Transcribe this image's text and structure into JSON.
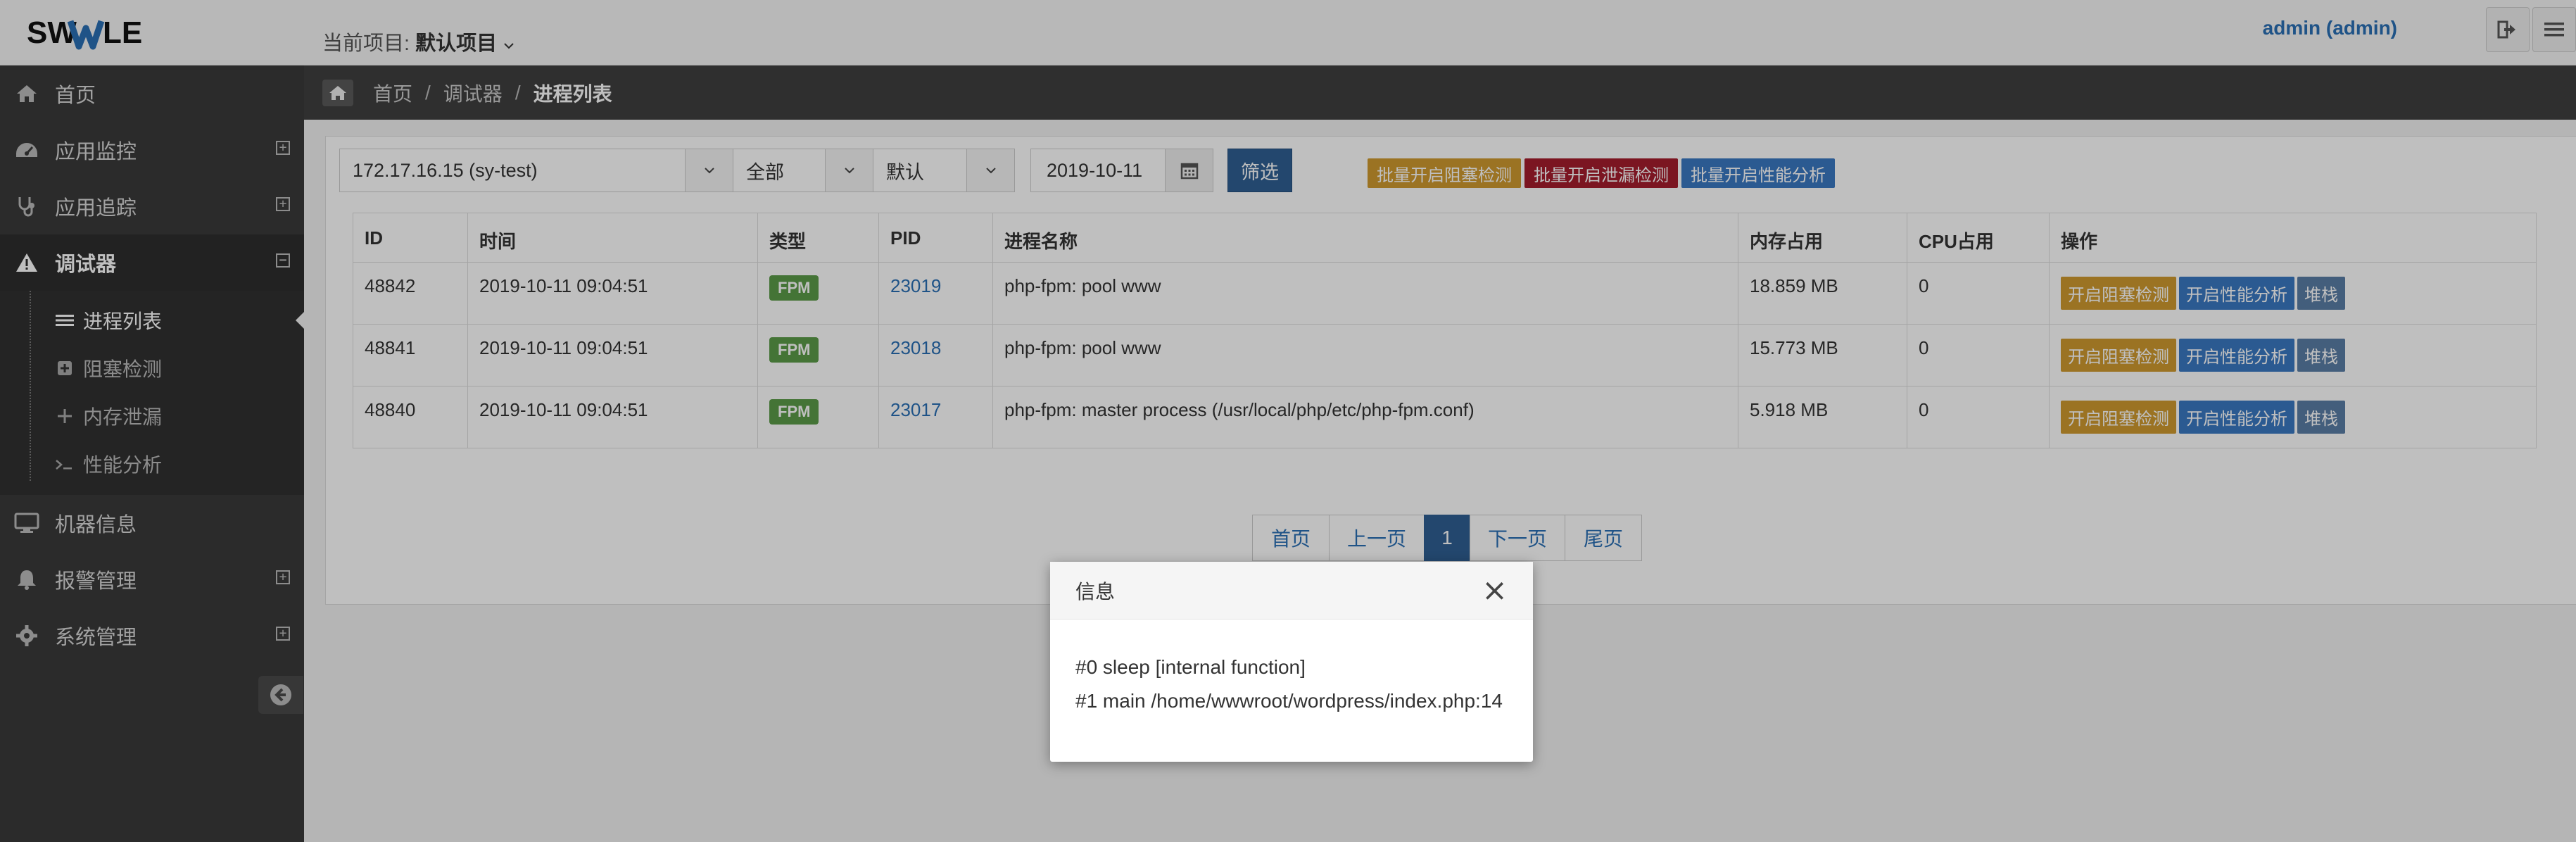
{
  "brand": {
    "logo_text": "SWOOLE"
  },
  "header": {
    "project_label": "当前项目:",
    "project_value": "默认项目",
    "user": "admin (admin)"
  },
  "sidebar": {
    "items": [
      {
        "label": "首页",
        "icon": "home-icon"
      },
      {
        "label": "应用监控",
        "icon": "dashboard-icon",
        "toggle": "+"
      },
      {
        "label": "应用追踪",
        "icon": "stethoscope-icon",
        "toggle": "+"
      },
      {
        "label": "调试器",
        "icon": "warning-icon",
        "toggle": "−"
      },
      {
        "label": "机器信息",
        "icon": "desktop-icon"
      },
      {
        "label": "报警管理",
        "icon": "bell-icon",
        "toggle": "+"
      },
      {
        "label": "系统管理",
        "icon": "gear-icon",
        "toggle": "+"
      }
    ],
    "subitems": [
      {
        "label": "进程列表",
        "icon": "list-icon"
      },
      {
        "label": "阻塞检测",
        "icon": "plus-square-icon"
      },
      {
        "label": "内存泄漏",
        "icon": "plus-icon"
      },
      {
        "label": "性能分析",
        "icon": "terminal-icon"
      }
    ]
  },
  "breadcrumb": {
    "home": "首页",
    "parent": "调试器",
    "current": "进程列表"
  },
  "filters": {
    "machine": "172.17.16.15 (sy-test)",
    "type": "全部",
    "order": "默认",
    "date": "2019-10-11",
    "submit": "筛选"
  },
  "batch_actions": [
    "批量开启阻塞检测",
    "批量开启泄漏检测",
    "批量开启性能分析"
  ],
  "table": {
    "columns": [
      "ID",
      "时间",
      "类型",
      "PID",
      "进程名称",
      "内存占用",
      "CPU占用",
      "操作"
    ],
    "rows": [
      {
        "id": "48842",
        "time": "2019-10-11 09:04:51",
        "type": "FPM",
        "pid": "23019",
        "name": "php-fpm: pool www",
        "mem": "18.859 MB",
        "cpu": "0"
      },
      {
        "id": "48841",
        "time": "2019-10-11 09:04:51",
        "type": "FPM",
        "pid": "23018",
        "name": "php-fpm: pool www",
        "mem": "15.773 MB",
        "cpu": "0"
      },
      {
        "id": "48840",
        "time": "2019-10-11 09:04:51",
        "type": "FPM",
        "pid": "23017",
        "name": "php-fpm: master process (/usr/local/php/etc/php-fpm.conf)",
        "mem": "5.918 MB",
        "cpu": "0"
      }
    ],
    "row_actions": [
      "开启阻塞检测",
      "开启性能分析",
      "堆栈"
    ]
  },
  "pagination": {
    "first": "首页",
    "prev": "上一页",
    "current": "1",
    "next": "下一页",
    "last": "尾页"
  },
  "modal": {
    "title": "信息",
    "close": "×",
    "lines": [
      "#0 sleep [internal function]",
      "#1 main /home/wwwroot/wordpress/index.php:14"
    ]
  },
  "colors": {
    "sidebar_bg": "#3a3a3a",
    "primary": "#2f5f93",
    "orange": "#cf9a2f",
    "red": "#a51d2d",
    "blue": "#3a78c2",
    "fpm_green": "#5b9b48"
  }
}
